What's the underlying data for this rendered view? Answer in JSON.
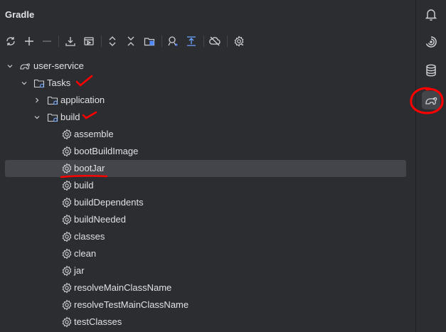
{
  "panel": {
    "title": "Gradle"
  },
  "toolbar": {
    "items": [
      {
        "name": "reload-icon"
      },
      {
        "name": "plus-icon"
      },
      {
        "name": "minus-icon"
      },
      {
        "name": "download-icon"
      },
      {
        "name": "run-config-icon"
      },
      {
        "name": "expand-all-icon"
      },
      {
        "name": "collapse-all-icon"
      },
      {
        "name": "dependencies-icon"
      },
      {
        "name": "analyze-icon"
      },
      {
        "name": "toggle-icon"
      },
      {
        "name": "offline-icon"
      },
      {
        "name": "settings-icon"
      }
    ]
  },
  "tree": {
    "root": "user-service",
    "tasks": "Tasks",
    "application": "application",
    "build_group": "build",
    "items": [
      "assemble",
      "bootBuildImage",
      "bootJar",
      "build",
      "buildDependents",
      "buildNeeded",
      "classes",
      "clean",
      "jar",
      "resolveMainClassName",
      "resolveTestMainClassName",
      "testClasses"
    ],
    "selected": "bootJar"
  },
  "rail": {
    "items": [
      {
        "name": "notifications-icon"
      },
      {
        "name": "ai-assistant-icon"
      },
      {
        "name": "database-icon"
      },
      {
        "name": "gradle-elephant-icon",
        "active": true
      }
    ]
  },
  "colors": {
    "background": "#2b2d30",
    "selection": "#43454a",
    "annotation": "#ff0000",
    "folder_accent": "#6ea6ff"
  }
}
